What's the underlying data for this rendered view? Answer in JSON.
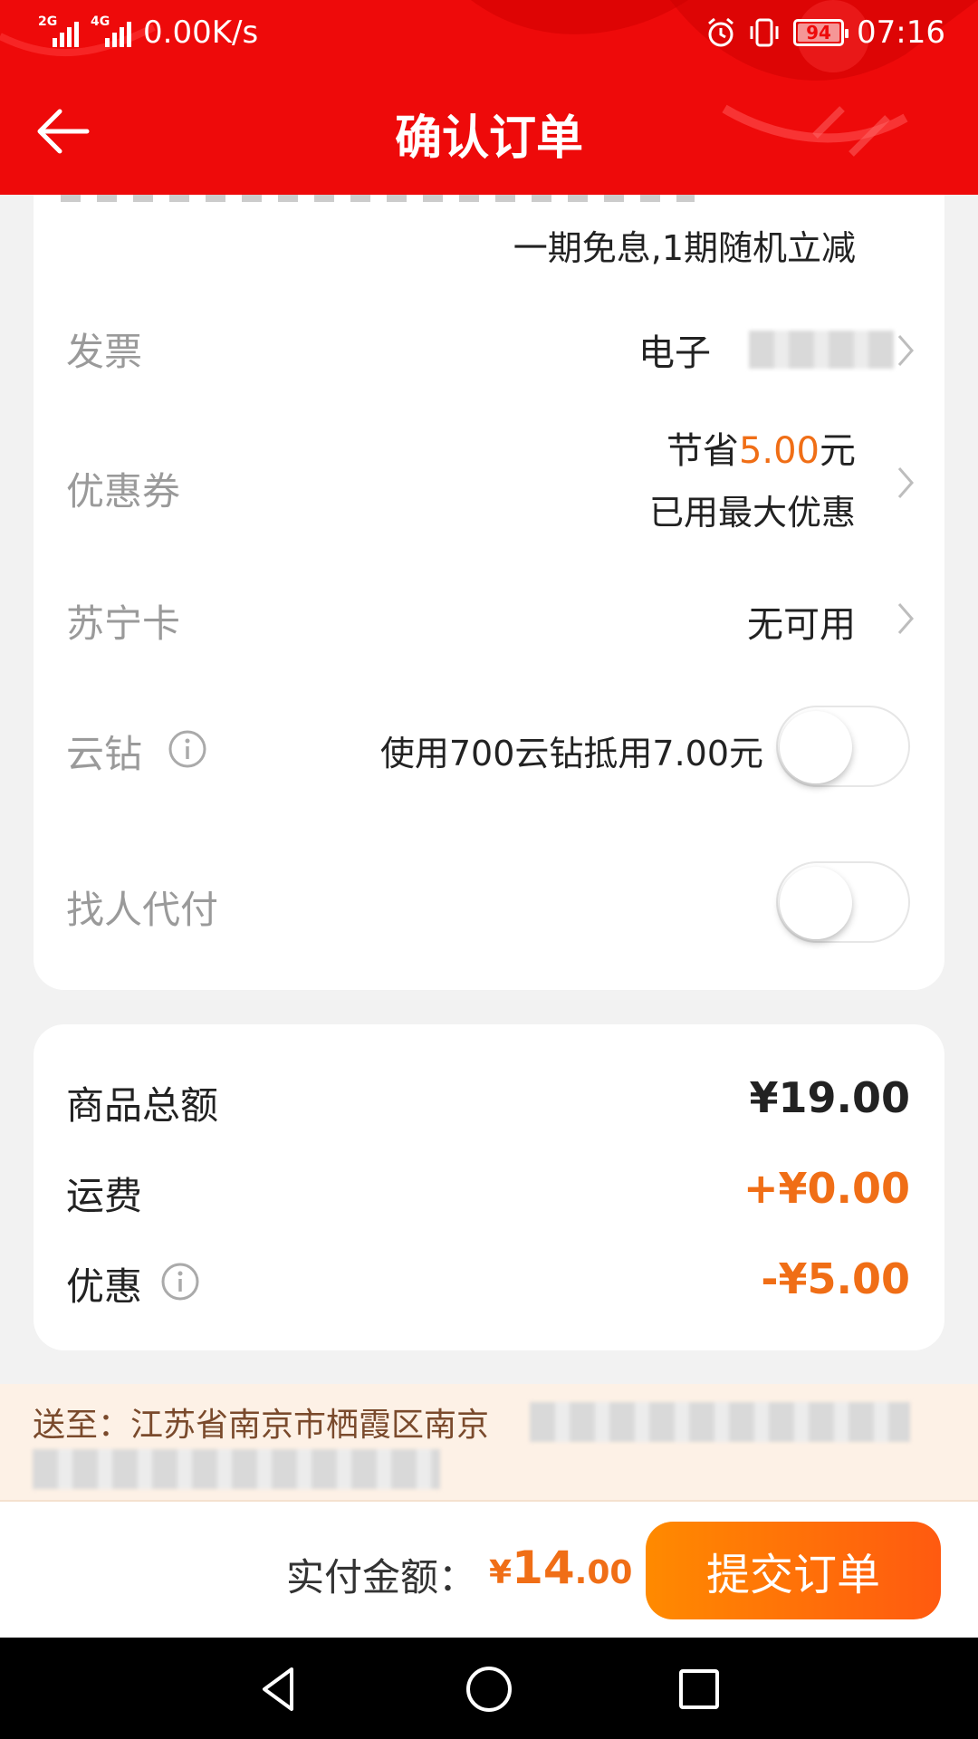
{
  "status_bar": {
    "network_1": "2G",
    "network_2": "4G",
    "speed": "0.00K/s",
    "battery": "94",
    "time": "07:16"
  },
  "header": {
    "title": "确认订单"
  },
  "installment": {
    "note": "一期免息,1期随机立减"
  },
  "invoice": {
    "label": "发票",
    "value": "电子"
  },
  "coupon": {
    "label": "优惠券",
    "save_prefix": "节省",
    "save_amount": "5.00",
    "save_suffix": "元",
    "status": "已用最大优惠"
  },
  "suning_card": {
    "label": "苏宁卡",
    "value": "无可用"
  },
  "cloud_diamond": {
    "label": "云钻",
    "text": "使用700云钻抵用7.00元",
    "enabled": false
  },
  "proxy_pay": {
    "label": "找人代付",
    "enabled": false
  },
  "summary": {
    "goods_label": "商品总额",
    "goods_value": "¥19.00",
    "shipping_label": "运费",
    "shipping_value": "+¥0.00",
    "discount_label": "优惠",
    "discount_value": "-¥5.00"
  },
  "address": {
    "text": "送至：江苏省南京市栖霞区南京"
  },
  "bottom_bar": {
    "pay_label": "实付金额：",
    "pay_currency": "¥",
    "pay_int": "14",
    "pay_dec": ".00",
    "submit_label": "提交订单"
  },
  "colors": {
    "header_red": "#ee0a0a",
    "accent_orange": "#f06e16",
    "submit_gradient_start": "#ff8a00",
    "submit_gradient_end": "#ff5a10"
  },
  "icons": [
    "back-arrow-icon",
    "alarm-icon",
    "vibrate-icon",
    "battery-icon",
    "chevron-right-icon",
    "info-icon",
    "nav-back-icon",
    "nav-home-icon",
    "nav-recents-icon"
  ]
}
